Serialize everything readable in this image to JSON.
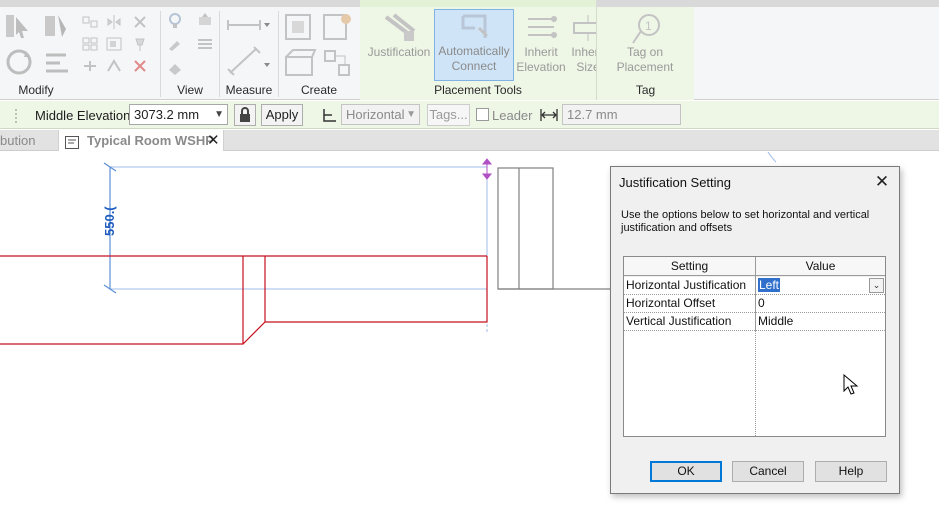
{
  "ribbon": {
    "panels": {
      "modify": "Modify",
      "view": "View",
      "measure": "Measure",
      "create": "Create",
      "placement_tools": "Placement Tools",
      "tag": "Tag"
    },
    "buttons": {
      "justification": "Justification",
      "auto_connect_1": "Automatically",
      "auto_connect_2": "Connect",
      "inherit_elevation_1": "Inherit",
      "inherit_elevation_2": "Elevation",
      "inherit_size_1": "Inherit",
      "inherit_size_2": "Size",
      "tag_on_placement_1": "Tag on",
      "tag_on_placement_2": "Placement"
    }
  },
  "options_bar": {
    "middle_elevation_label": "Middle Elevation:",
    "middle_elevation_value": "3073.2 mm",
    "apply_label": "Apply",
    "orientation_value": "Horizontal",
    "tags_label": "Tags...",
    "leader_label": "Leader",
    "leader_length_value": "12.7 mm"
  },
  "view_tabs": [
    {
      "label": "bution",
      "active": false
    },
    {
      "label": "Typical Room WSHP",
      "active": true
    }
  ],
  "canvas": {
    "dimension_text": "550.("
  },
  "dialog": {
    "title": "Justification Setting",
    "description": "Use the options below to set horizontal and vertical justification and offsets",
    "columns": [
      "Setting",
      "Value"
    ],
    "rows": [
      {
        "setting": "Horizontal Justification",
        "value": "Left"
      },
      {
        "setting": "Horizontal Offset",
        "value": "0"
      },
      {
        "setting": "Vertical Justification",
        "value": "Middle"
      }
    ],
    "buttons": {
      "ok": "OK",
      "cancel": "Cancel",
      "help": "Help"
    }
  },
  "colors": {
    "context_tab_green": "#eef6e6",
    "duct_red": "#c8101e",
    "dimension_blue": "#5b8fd6",
    "selection_blue": "#3070cc"
  }
}
